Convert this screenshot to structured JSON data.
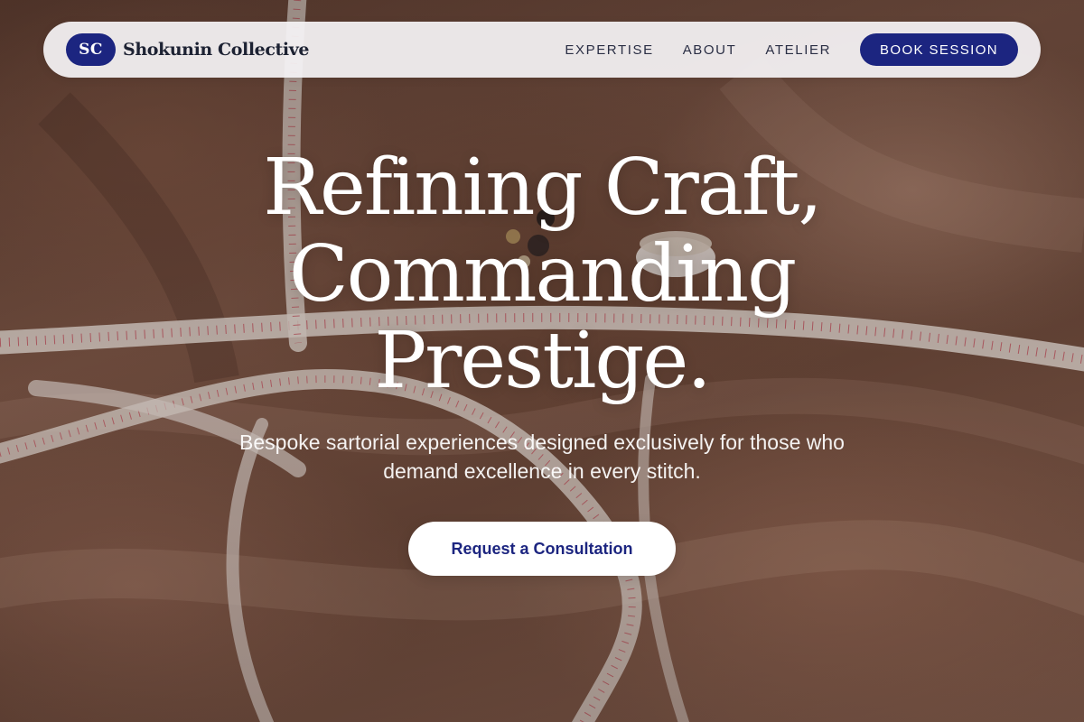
{
  "brand": {
    "badge": "SC",
    "name": "Shokunin Collective"
  },
  "nav": {
    "links": [
      "EXPERTISE",
      "ABOUT",
      "ATELIER"
    ],
    "cta_label": "BOOK SESSION"
  },
  "hero": {
    "headline_lines": [
      "Refining Craft,",
      "Commanding",
      "Prestige."
    ],
    "subtitle": "Bespoke sartorial experiences designed exclusively for those who demand excellence in every stitch.",
    "cta_label": "Request a Consultation",
    "background": "fabric-and-tape-measure-photo"
  },
  "colors": {
    "accent_navy": "#1c2580",
    "nav_background": "#f5f3f5",
    "text_dark": "#1d2233",
    "fabric_tone": "#7a5444",
    "tape_red": "#c0394a"
  }
}
